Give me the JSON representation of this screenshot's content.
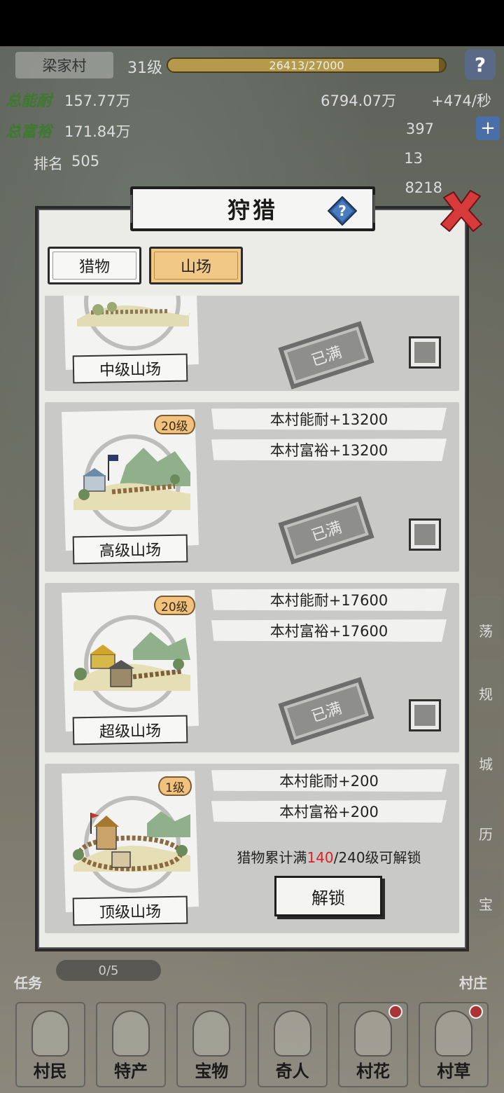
{
  "hud": {
    "village_name": "梁家村",
    "village_level": "31级",
    "exp_text": "26413/27000",
    "exp_progress": 0.978,
    "stats": [
      {
        "label": "总能耐",
        "value": "157.77万"
      },
      {
        "label": "总富裕",
        "value": "171.84万"
      },
      {
        "label": "排名",
        "value": "505"
      }
    ],
    "coins": "6794.07万",
    "coin_rate": "+474/秒",
    "gold": "397",
    "tickets": "13",
    "other": "8218",
    "help_icon": "question-icon",
    "side_buttons": [
      "荡",
      "规",
      "城",
      "历",
      "宝"
    ],
    "task_label": "任务",
    "task_count": "0/5",
    "village_btn": "村庄"
  },
  "bottom_nav": [
    {
      "label": "村民",
      "dot": false
    },
    {
      "label": "特产",
      "dot": false
    },
    {
      "label": "宝物",
      "dot": false
    },
    {
      "label": "奇人",
      "dot": false
    },
    {
      "label": "村花",
      "dot": true
    },
    {
      "label": "村草",
      "dot": true
    }
  ],
  "modal": {
    "title": "狩猎",
    "tabs": [
      {
        "label": "猎物",
        "active": false
      },
      {
        "label": "山场",
        "active": true
      }
    ],
    "cards": [
      {
        "name": "中级山场",
        "level": "",
        "bonuses": [],
        "status": "已满",
        "locked": false
      },
      {
        "name": "高级山场",
        "level": "20级",
        "bonuses": [
          "本村能耐+13200",
          "本村富裕+13200"
        ],
        "status": "已满",
        "locked": false
      },
      {
        "name": "超级山场",
        "level": "20级",
        "bonuses": [
          "本村能耐+17600",
          "本村富裕+17600"
        ],
        "status": "已满",
        "locked": false
      },
      {
        "name": "顶级山场",
        "level": "1级",
        "bonuses": [
          "本村能耐+200",
          "本村富裕+200"
        ],
        "locked": true,
        "unlock_prefix": "猎物累计满",
        "unlock_current": "140",
        "unlock_suffix": "/240级可解锁",
        "unlock_button": "解锁"
      }
    ]
  },
  "colors": {
    "active_tab": "#f1c886",
    "level_badge": "#f0c27e",
    "close_red": "#d63a3a",
    "unlock_highlight": "#e02020"
  }
}
